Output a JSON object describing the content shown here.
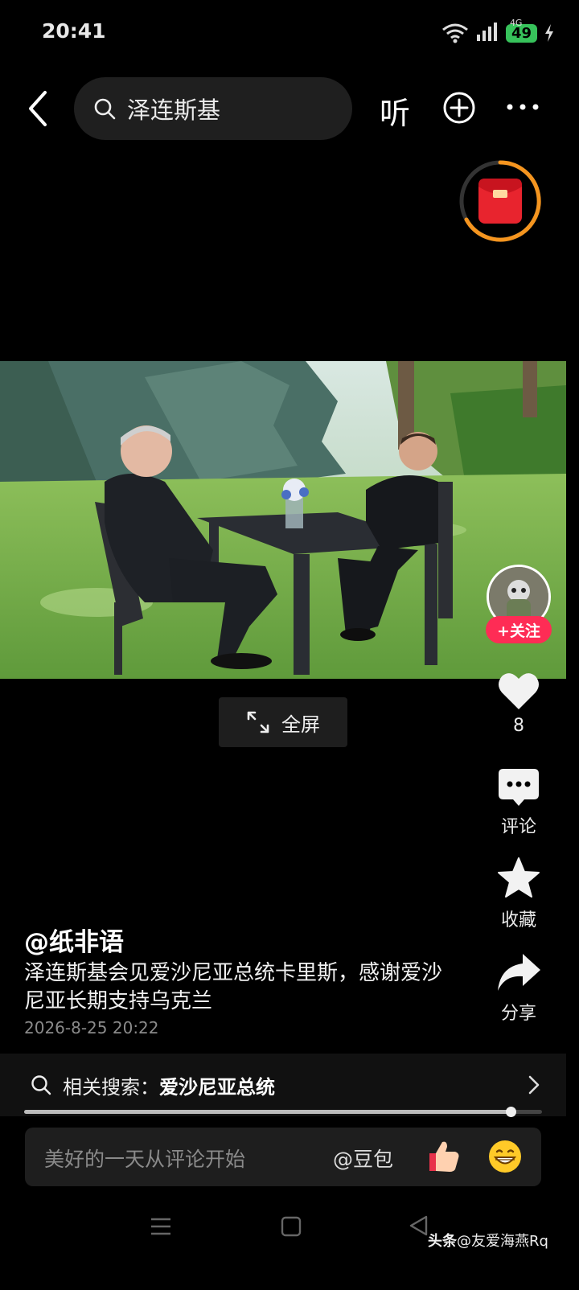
{
  "status_bar": {
    "time": "20:41",
    "network": "4G",
    "battery": "49"
  },
  "top_nav": {
    "search_query": "泽连斯基",
    "listen_label": "听"
  },
  "video": {
    "fullscreen_label": "全屏",
    "progress": 0.94
  },
  "right_rail": {
    "follow_label": "+关注",
    "like_count": "8",
    "comment_label": "评论",
    "favorite_label": "收藏",
    "share_label": "分享"
  },
  "post": {
    "author": "@纸非语",
    "title": "泽连斯基会见爱沙尼亚总统卡里斯，感谢爱沙尼亚长期支持乌克兰",
    "date": "2026-8-25 20:22"
  },
  "related_search": {
    "prefix": "相关搜索：",
    "term": "爱沙尼亚总统"
  },
  "comment_bar": {
    "placeholder": "美好的一天从评论开始",
    "mention": "@豆包"
  },
  "watermark": {
    "brand": "头条",
    "handle": "@友爱海燕Rq"
  },
  "colors": {
    "accent_red": "#fe2c55",
    "battery_green": "#37c25b",
    "red_packet_ring": "#f5951f"
  }
}
